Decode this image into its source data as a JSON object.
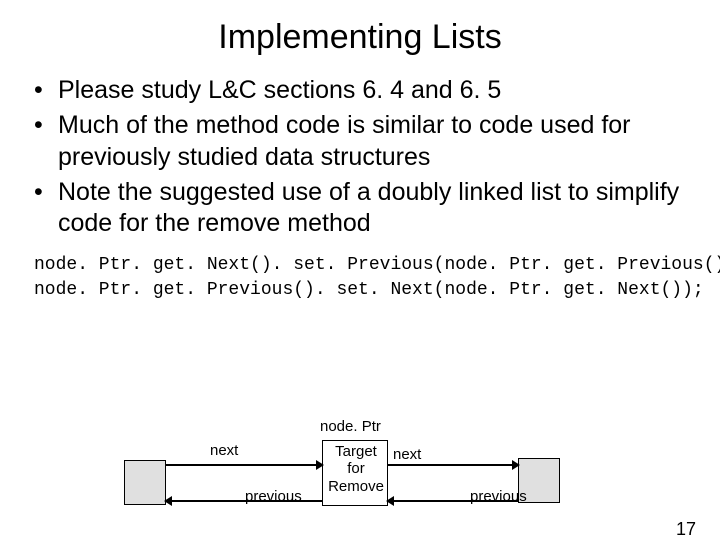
{
  "title": "Implementing Lists",
  "bullets": [
    "Please study L&C sections 6. 4 and 6. 5",
    "Much of the method code is similar to code used for previously studied data structures",
    "Note the suggested use of a doubly linked list to simplify code for the remove method"
  ],
  "code_lines": [
    "node. Ptr. get. Next(). set. Previous(node. Ptr. get. Previous());",
    "node. Ptr. get. Previous(). set. Next(node. Ptr. get. Next());"
  ],
  "diagram": {
    "nodeptr_label": "node. Ptr",
    "center_line1": "Target",
    "center_line2": "for",
    "center_line3": "Remove",
    "next_label": "next",
    "previous_label": "previous"
  },
  "page_number": "17"
}
